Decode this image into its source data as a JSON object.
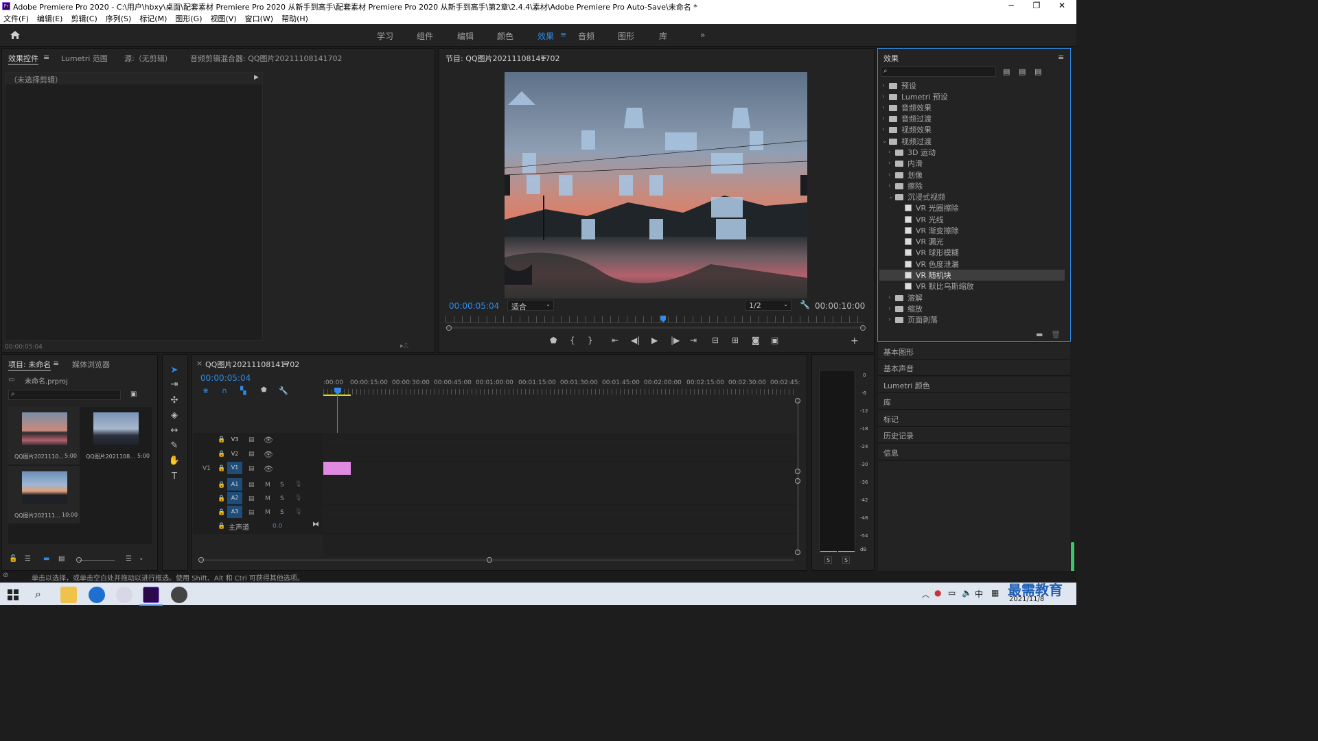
{
  "window": {
    "title": "Adobe Premiere Pro 2020 - C:\\用户\\hbxy\\桌面\\配套素材 Premiere Pro 2020 从新手到高手\\配套素材 Premiere Pro 2020 从新手到高手\\第2章\\2.4.4\\素材\\Adobe Premiere Pro Auto-Save\\未命名 *",
    "logo": "Pr",
    "min": "─",
    "max": "❐",
    "close": "✕"
  },
  "menu": [
    "文件(F)",
    "编辑(E)",
    "剪辑(C)",
    "序列(S)",
    "标记(M)",
    "图形(G)",
    "视图(V)",
    "窗口(W)",
    "帮助(H)"
  ],
  "workspaces": [
    "学习",
    "组件",
    "编辑",
    "颜色",
    "效果",
    "音频",
    "图形",
    "库"
  ],
  "active_workspace": "效果",
  "ws_more": "»",
  "source_panel": {
    "tabs": [
      "效果控件",
      "Lumetri 范围",
      "源:（无剪辑）",
      "音频剪辑混合器: QQ图片20211108141702"
    ],
    "no_clip": "（未选择剪辑）",
    "timecode": "00:00:05:04"
  },
  "program": {
    "title": "节目: QQ图片20211108141702",
    "timecode": "00:00:05:04",
    "fit": "适合",
    "res": "1/2",
    "duration": "00:00:10:00",
    "playhead_fraction": 0.52
  },
  "effects": {
    "title": "效果",
    "search_placeholder": "",
    "top_folders": [
      "预设",
      "Lumetri 预设",
      "音频效果",
      "音频过渡",
      "视频效果",
      "视频过渡"
    ],
    "sub_folders": [
      "3D 运动",
      "内滑",
      "划像",
      "擦除",
      "沉浸式视频"
    ],
    "vr_items": [
      "VR 光圈擦除",
      "VR 光线",
      "VR 渐变擦除",
      "VR 漏光",
      "VR 球形模糊",
      "VR 色度泄漏",
      "VR 随机块",
      "VR 默比乌斯缩放"
    ],
    "selected": "VR 随机块",
    "after_folders": [
      "溶解",
      "缩放",
      "页面剥落"
    ]
  },
  "side_panels": [
    "基本图形",
    "基本声音",
    "Lumetri 颜色",
    "库",
    "标记",
    "历史记录",
    "信息"
  ],
  "project": {
    "tabs": [
      "项目: 未命名",
      "媒体浏览器"
    ],
    "file": "未命名.prproj",
    "items": [
      {
        "name": "QQ图片2021110...",
        "dur": "5:00"
      },
      {
        "name": "QQ图片2021108...",
        "dur": "5:00"
      },
      {
        "name": "QQ图片202111...",
        "dur": "10:00"
      }
    ]
  },
  "timeline": {
    "tab": "QQ图片20211108141702",
    "timecode": "00:00:05:04",
    "ruler": [
      ":00:00",
      "00:00:15:00",
      "00:00:30:00",
      "00:00:45:00",
      "00:01:00:00",
      "00:01:15:00",
      "00:01:30:00",
      "00:01:45:00",
      "00:02:00:00",
      "00:02:15:00",
      "00:02:30:00",
      "00:02:45:"
    ],
    "video_tracks": [
      "V3",
      "V2",
      "V1"
    ],
    "audio_tracks": [
      "A1",
      "A2",
      "A3"
    ],
    "source_v": "V1",
    "m": "M",
    "s": "S",
    "master": "主声道",
    "master_val": "0.0"
  },
  "meter": {
    "scale": [
      "0",
      "-6",
      "-12",
      "-18",
      "-24",
      "-30",
      "-36",
      "-42",
      "-48",
      "-54",
      "dB"
    ],
    "solo": [
      "S",
      "S"
    ]
  },
  "status": "单击以选择，或单击空白处并拖动以进行框选。使用 Shift、Alt 和 Ctrl 可获得其他选项。",
  "taskbar": {
    "ime": "中",
    "date": "2021/11/8",
    "watermark": "最需教育"
  },
  "colors": {
    "accent": "#2d8ceb",
    "clip": "#e08be0",
    "panel": "#232323"
  }
}
